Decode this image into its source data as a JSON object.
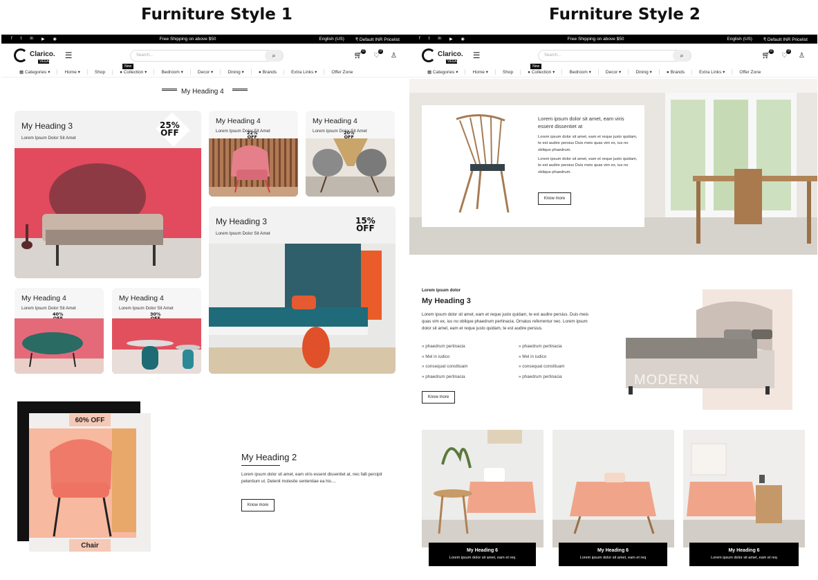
{
  "titles": {
    "style1": "Furniture Style 1",
    "style2": "Furniture Style 2"
  },
  "topbar": {
    "shipping": "Free Shipping on above $50",
    "language": "English (US)",
    "pricelist": "₹ Default INR Pricelist",
    "social": [
      "f",
      "t",
      "in",
      "▶",
      "◉"
    ]
  },
  "header": {
    "logo_text": "Clarico.",
    "logo_sub": "VEGA",
    "search_placeholder": "Search...",
    "cart_count": "0",
    "wish_count": "0"
  },
  "nav": {
    "items": [
      "Categories",
      "Home",
      "Shop",
      "Collection",
      "Bedroom",
      "Decor",
      "Dining",
      "Brands",
      "Extra Links",
      "Offer Zone"
    ],
    "new_label": "New"
  },
  "style1": {
    "section_heading": "My Heading 4",
    "big_card": {
      "title": "My Heading 3",
      "subtitle": "Lorem Ipsum Dolor Sit Amet",
      "offer": "25%\nOFF"
    },
    "card_chair": {
      "title": "My Heading 4",
      "subtitle": "Lorem Ipsum Dolor Sit Amet",
      "offer": "22%\nOFF"
    },
    "card_chairs": {
      "title": "My Heading 4",
      "subtitle": "Lorem Ipsum Dolor Sit Amet",
      "offer": "20%\nOFF"
    },
    "card_bed2": {
      "title": "My Heading 3",
      "subtitle": "Lorem Ipsum Dolor Sit Amet",
      "offer": "15%\nOFF"
    },
    "card_ottoman": {
      "title": "My Heading 4",
      "subtitle": "Lorem Ipsum Dolor Sit Amet",
      "offer": "40%\nOFF"
    },
    "card_tables": {
      "title": "My Heading 4",
      "subtitle": "Lorem Ipsum Dolor Sit Amet",
      "offer": "30%\nOFF"
    },
    "promo": {
      "offer": "60% OFF",
      "label": "Chair",
      "title": "My Heading 2",
      "body": "Lorem ipsum dolor sit amet, eam viris essent dissentiet at, nec falli percipit petentium ut. Delenit molestie sententiae ea his....",
      "button": "Know more"
    }
  },
  "style2": {
    "hero": {
      "title": "Lorem ipsum dolor sit amet, eam viris essent dissentiet at",
      "body1": "Lorem ipsum dolor sit amet, eam et reque justo quidam, te est audire persius Duis meis quas vim ex, ius no oblique phaedrum.",
      "body2": "Lorem ipsum dolor sit amet, eam et reque justo quidam, te est audire persius Duis meis quas vim ex, ius no oblique phaedrum.",
      "button": "Know more"
    },
    "section": {
      "kicker": "Lorem ipsum dolor",
      "title": "My Heading 3",
      "body": "Lorem ipsum dolor sit amet, eam et reque justo quidam, te est audire persius. Duis meis quas vim ex, ius no oblique phaedrum pertinacia. Ornatus referrentur nec. Lorem ipsum dolor sit amet, eam et reque justo quidam, te est audire persius.",
      "list_left": [
        "phaedrum pertinacia",
        "Mel in iudico",
        "consequat constituam",
        "phaedrum pertinacia"
      ],
      "list_right": [
        "phaedrum pertinacia",
        "Mel in iudico",
        "consequat constituam",
        "phaedrum pertinacia"
      ],
      "button": "Know more",
      "image_word": "MODERN"
    },
    "tiles": [
      {
        "title": "My Heading 6",
        "subtitle": "Lorem ipsum dolor sit amet, eam et req"
      },
      {
        "title": "My Heading 6",
        "subtitle": "Lorem ipsum dolor sit amet, eam et req"
      },
      {
        "title": "My Heading 6",
        "subtitle": "Lorem ipsum dolor sit amet, eam et req"
      }
    ]
  }
}
